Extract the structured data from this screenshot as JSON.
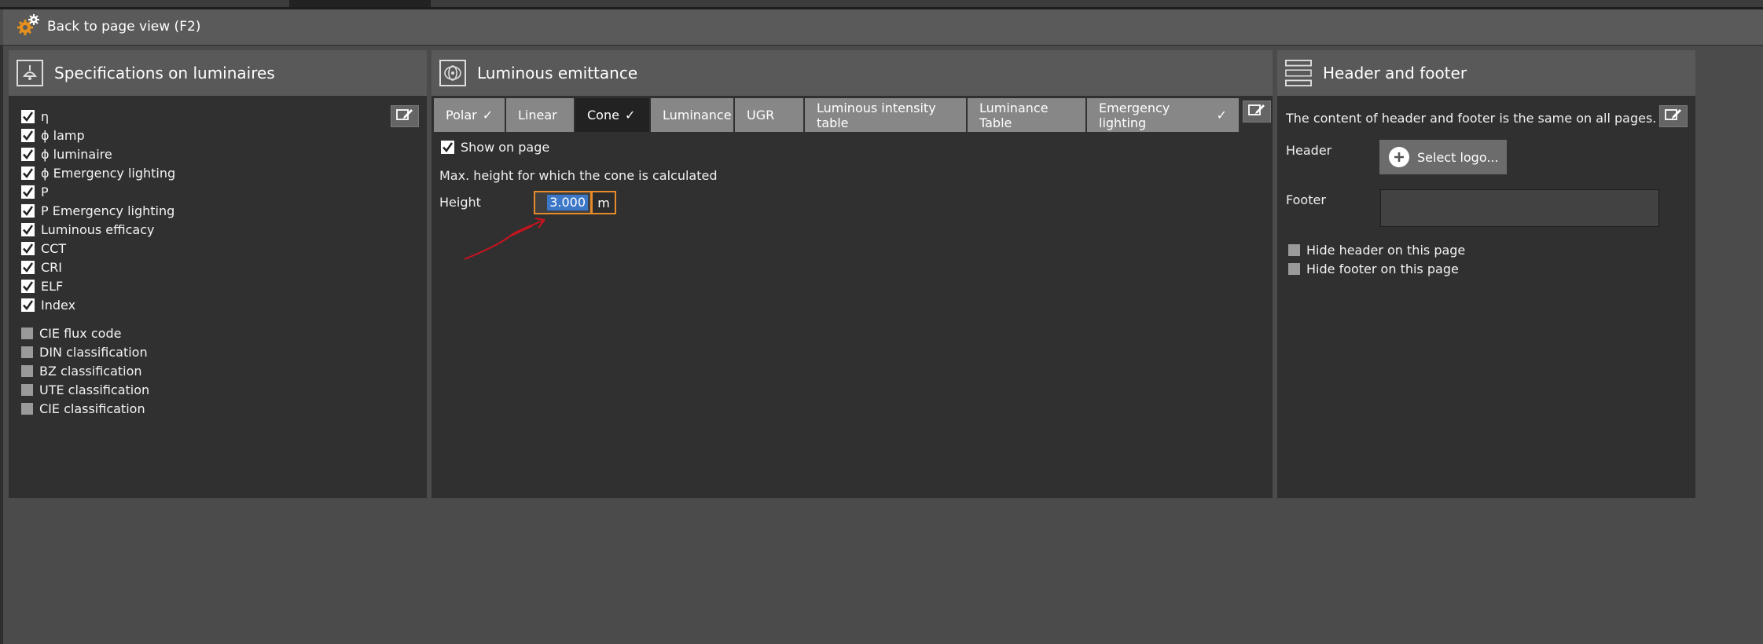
{
  "backbar": {
    "label": "Back to page view (F2)",
    "icon": "gear-icon"
  },
  "panels": {
    "specs": {
      "title": "Specifications on luminaires",
      "checked": [
        "η",
        "ϕ lamp",
        "ϕ luminaire",
        "ϕ Emergency lighting",
        "P",
        "P Emergency lighting",
        "Luminous efficacy",
        "CCT",
        "CRI",
        "ELF",
        "Index"
      ],
      "unchecked": [
        "CIE flux code",
        "DIN classification",
        "BZ classification",
        "UTE classification",
        "CIE classification"
      ]
    },
    "emittance": {
      "title": "Luminous emittance",
      "tabs": [
        {
          "label": "Polar",
          "check": "✓"
        },
        {
          "label": "Linear",
          "check": ""
        },
        {
          "label": "Cone",
          "check": "✓"
        },
        {
          "label": "Luminance",
          "check": ""
        },
        {
          "label": "UGR",
          "check": ""
        },
        {
          "label": "Luminous intensity table",
          "check": ""
        },
        {
          "label": "Luminance Table",
          "check": ""
        },
        {
          "label": "Emergency lighting",
          "check": "✓"
        }
      ],
      "active_tab": "Cone",
      "show_on_page": "Show on page",
      "max_height_label": "Max. height for which the cone is calculated",
      "height_label": "Height",
      "height_value": "3.000",
      "unit": "m"
    },
    "header_footer": {
      "title": "Header and footer",
      "info": "The content of header and footer is the same on all pages.",
      "header_label": "Header",
      "select_logo": "Select logo...",
      "footer_label": "Footer",
      "hide_header": "Hide header on this page",
      "hide_footer": "Hide footer on this page"
    }
  },
  "colors": {
    "accent_orange": "#e68a2a",
    "selection_blue": "#3d78c8",
    "annotation_red": "#c8141e"
  }
}
